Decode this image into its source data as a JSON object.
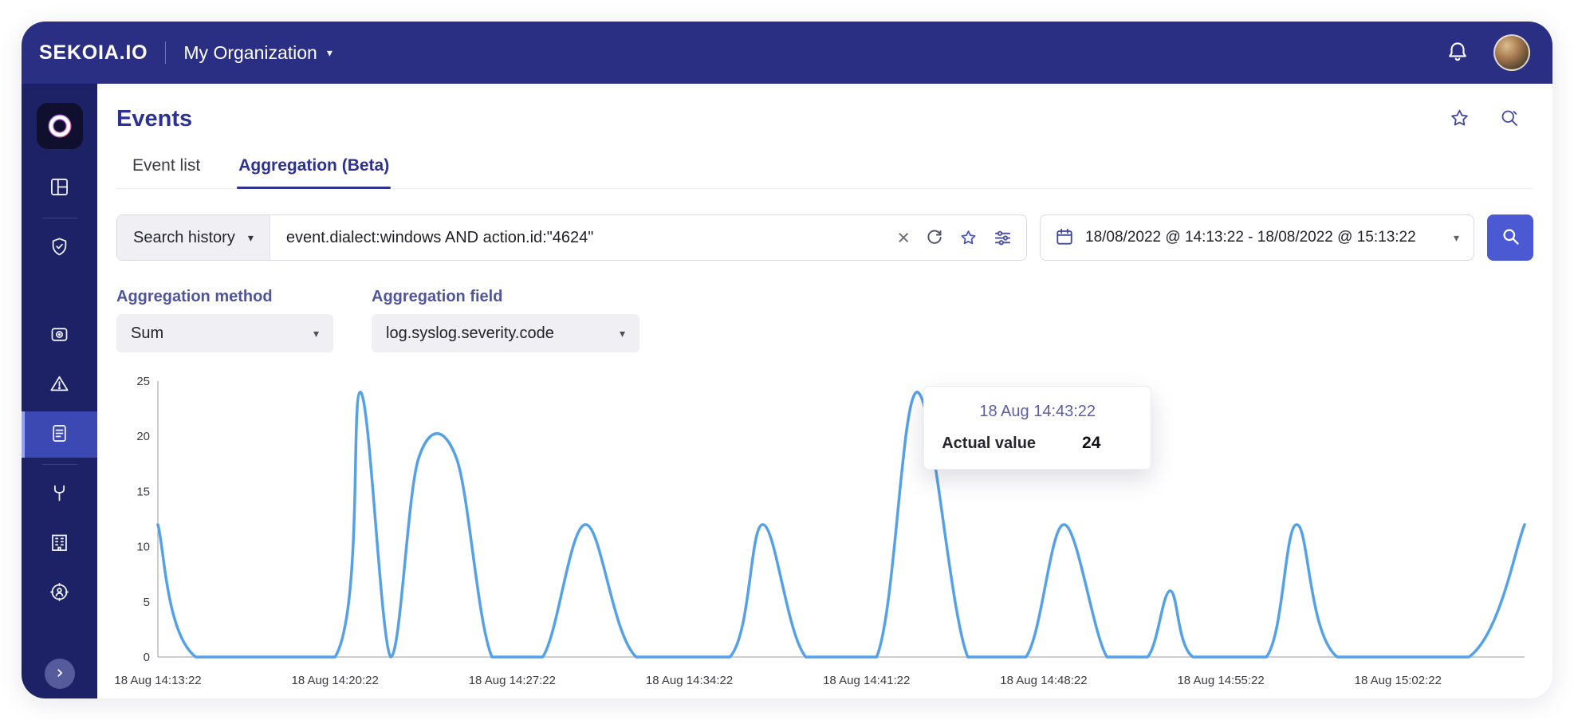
{
  "topbar": {
    "brand": "SEKOIA.IO",
    "organization": "My Organization"
  },
  "icons": {
    "caret_down": "▾",
    "close": "×"
  },
  "sidebar": {
    "items": [
      "logo",
      "dashboard",
      "shield",
      "intakes",
      "alerts",
      "events",
      "hunting",
      "organization",
      "cti",
      "collapse"
    ],
    "active_item": "events"
  },
  "page": {
    "title": "Events",
    "tabs": [
      {
        "label": "Event list"
      },
      {
        "label": "Aggregation (Beta)"
      }
    ],
    "active_tab": "Aggregation (Beta)"
  },
  "search": {
    "history_label": "Search history",
    "query": "event.dialect:windows AND action.id:\"4624\"",
    "date_range": "18/08/2022 @ 14:13:22 - 18/08/2022 @ 15:13:22"
  },
  "aggregation": {
    "method_label": "Aggregation method",
    "method_value": "Sum",
    "field_label": "Aggregation field",
    "field_value": "log.syslog.severity.code"
  },
  "tooltip": {
    "title": "18 Aug 14:43:22",
    "label": "Actual value",
    "value": "24"
  },
  "chart_data": {
    "type": "line",
    "title": "",
    "color": "#55a1e8",
    "ylim": [
      0,
      25
    ],
    "yticks": [
      0,
      5,
      10,
      15,
      20,
      25
    ],
    "grid": false,
    "legend": false,
    "x_unit": "minutes after 18 Aug 2022 14:13:22",
    "x_range": [
      0,
      54
    ],
    "x_ticks": [
      {
        "t": 0,
        "label": "18 Aug 14:13:22"
      },
      {
        "t": 7,
        "label": "18 Aug 14:20:22"
      },
      {
        "t": 14,
        "label": "18 Aug 14:27:22"
      },
      {
        "t": 21,
        "label": "18 Aug 14:34:22"
      },
      {
        "t": 28,
        "label": "18 Aug 14:41:22"
      },
      {
        "t": 35,
        "label": "18 Aug 14:48:22"
      },
      {
        "t": 42,
        "label": "18 Aug 14:55:22"
      },
      {
        "t": 49,
        "label": "18 Aug 15:02:22"
      }
    ],
    "points": [
      [
        0,
        12
      ],
      [
        1.5,
        0
      ],
      [
        7,
        0
      ],
      [
        8,
        24
      ],
      [
        9.2,
        0
      ],
      [
        10.3,
        18
      ],
      [
        11.8,
        18
      ],
      [
        13.2,
        0
      ],
      [
        15.2,
        0
      ],
      [
        16.9,
        12
      ],
      [
        18.9,
        0
      ],
      [
        22.6,
        0
      ],
      [
        23.9,
        12
      ],
      [
        25.6,
        0
      ],
      [
        28.4,
        0
      ],
      [
        30,
        24
      ],
      [
        32,
        0
      ],
      [
        34.3,
        0
      ],
      [
        35.8,
        12
      ],
      [
        37.5,
        0
      ],
      [
        39.1,
        0
      ],
      [
        40,
        6
      ],
      [
        40.9,
        0
      ],
      [
        43.8,
        0
      ],
      [
        45,
        12
      ],
      [
        46.6,
        0
      ],
      [
        51.8,
        0
      ],
      [
        54,
        12
      ]
    ],
    "tooltip_point": {
      "t": 30,
      "value": 24,
      "label": "18 Aug 14:43:22"
    }
  }
}
